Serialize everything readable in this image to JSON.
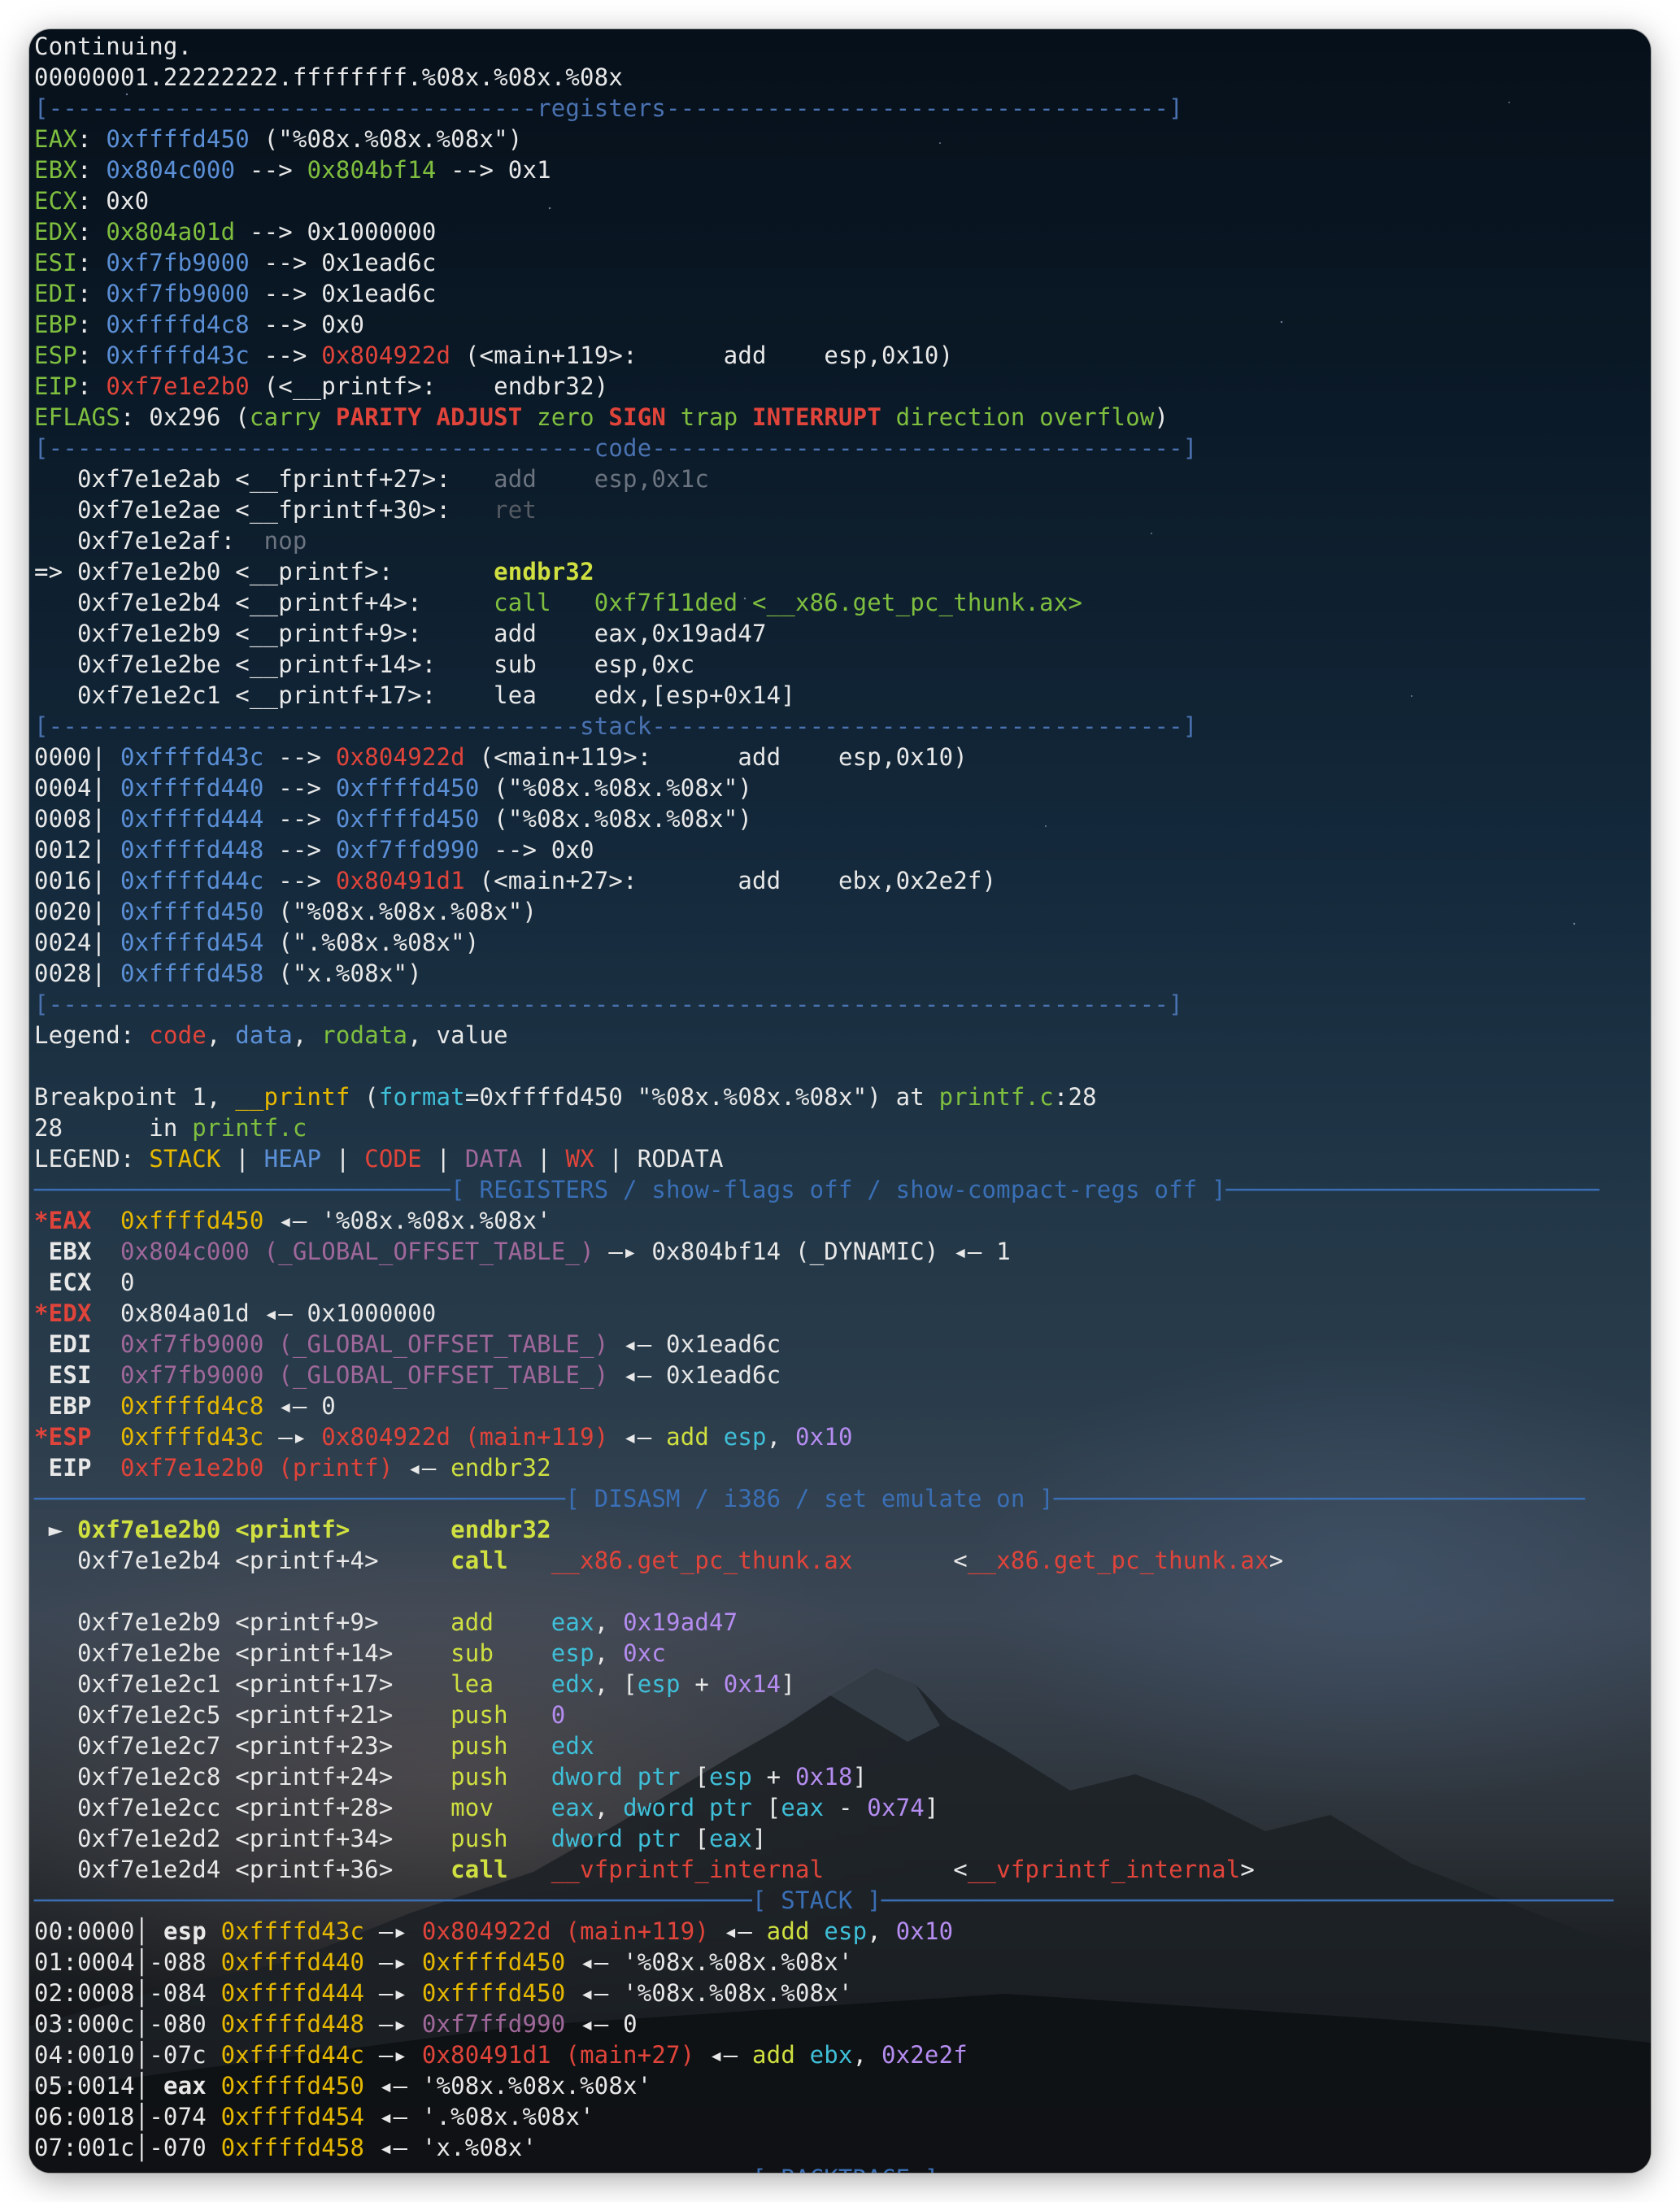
{
  "lines": [
    [
      [
        "w",
        "Continuing."
      ]
    ],
    [
      [
        "w",
        "00000001.22222222.ffffffff.%08x.%08x.%08x"
      ]
    ],
    [
      [
        "sepb",
        "[----------------------------------"
      ],
      [
        "sepb",
        "registers"
      ],
      [
        "sepb",
        "-----------------------------------]"
      ]
    ],
    [
      [
        "g",
        "EAX"
      ],
      [
        "w",
        ": "
      ],
      [
        "b",
        "0xffffd450"
      ],
      [
        "w",
        " (\"%08x.%08x.%08x\")"
      ]
    ],
    [
      [
        "g",
        "EBX"
      ],
      [
        "w",
        ": "
      ],
      [
        "b",
        "0x804c000"
      ],
      [
        "w",
        " --> "
      ],
      [
        "g",
        "0x804bf14"
      ],
      [
        "w",
        " --> 0x1"
      ]
    ],
    [
      [
        "g",
        "ECX"
      ],
      [
        "w",
        ": 0x0"
      ]
    ],
    [
      [
        "g",
        "EDX"
      ],
      [
        "w",
        ": "
      ],
      [
        "g",
        "0x804a01d"
      ],
      [
        "w",
        " --> 0x1000000"
      ]
    ],
    [
      [
        "g",
        "ESI"
      ],
      [
        "w",
        ": "
      ],
      [
        "b",
        "0xf7fb9000"
      ],
      [
        "w",
        " --> 0x1ead6c"
      ]
    ],
    [
      [
        "g",
        "EDI"
      ],
      [
        "w",
        ": "
      ],
      [
        "b",
        "0xf7fb9000"
      ],
      [
        "w",
        " --> 0x1ead6c"
      ]
    ],
    [
      [
        "g",
        "EBP"
      ],
      [
        "w",
        ": "
      ],
      [
        "b",
        "0xffffd4c8"
      ],
      [
        "w",
        " --> 0x0"
      ]
    ],
    [
      [
        "g",
        "ESP"
      ],
      [
        "w",
        ": "
      ],
      [
        "b",
        "0xffffd43c"
      ],
      [
        "w",
        " --> "
      ],
      [
        "r",
        "0x804922d"
      ],
      [
        "w",
        " (<main+119>:      add    esp,0x10)"
      ]
    ],
    [
      [
        "g",
        "EIP"
      ],
      [
        "w",
        ": "
      ],
      [
        "r",
        "0xf7e1e2b0"
      ],
      [
        "w",
        " (<__printf>:    endbr32)"
      ]
    ],
    [
      [
        "g",
        "EFLAGS"
      ],
      [
        "w",
        ": 0x296 ("
      ],
      [
        "g",
        "carry "
      ],
      [
        "rb",
        "PARITY ADJUST "
      ],
      [
        "g",
        "zero "
      ],
      [
        "rb",
        "SIGN "
      ],
      [
        "g",
        "trap "
      ],
      [
        "rb",
        "INTERRUPT "
      ],
      [
        "g",
        "direction overflow"
      ],
      [
        "w",
        ")"
      ]
    ],
    [
      [
        "sepb",
        "[--------------------------------------"
      ],
      [
        "sepb",
        "code"
      ],
      [
        "sepb",
        "-------------------------------------]"
      ]
    ],
    [
      [
        "w",
        "   0xf7e1e2ab <__fprintf+27>:   "
      ],
      [
        "gray",
        "add    esp,0x1c"
      ]
    ],
    [
      [
        "w",
        "   0xf7e1e2ae <__fprintf+30>:   "
      ],
      [
        "dk",
        "ret"
      ]
    ],
    [
      [
        "w",
        "   0xf7e1e2af:  "
      ],
      [
        "gray",
        "nop"
      ]
    ],
    [
      [
        "w",
        "=> 0xf7e1e2b0 <__printf>:       "
      ],
      [
        "ygb",
        "endbr32"
      ]
    ],
    [
      [
        "w",
        "   0xf7e1e2b4 <__printf+4>:     "
      ],
      [
        "g",
        "call   0xf7f11ded <__x86.get_pc_thunk.ax>"
      ]
    ],
    [
      [
        "w",
        "   0xf7e1e2b9 <__printf+9>:     add    eax,0x19ad47"
      ]
    ],
    [
      [
        "w",
        "   0xf7e1e2be <__printf+14>:    sub    esp,0xc"
      ]
    ],
    [
      [
        "w",
        "   0xf7e1e2c1 <__printf+17>:    lea    edx,[esp+0x14]"
      ]
    ],
    [
      [
        "sepb",
        "[-------------------------------------"
      ],
      [
        "sepb",
        "stack"
      ],
      [
        "sepb",
        "-------------------------------------]"
      ]
    ],
    [
      [
        "w",
        "0000| "
      ],
      [
        "b",
        "0xffffd43c"
      ],
      [
        "w",
        " --> "
      ],
      [
        "r",
        "0x804922d"
      ],
      [
        "w",
        " (<main+119>:      add    esp,0x10)"
      ]
    ],
    [
      [
        "w",
        "0004| "
      ],
      [
        "b",
        "0xffffd440"
      ],
      [
        "w",
        " --> "
      ],
      [
        "b",
        "0xffffd450"
      ],
      [
        "w",
        " (\"%08x.%08x.%08x\")"
      ]
    ],
    [
      [
        "w",
        "0008| "
      ],
      [
        "b",
        "0xffffd444"
      ],
      [
        "w",
        " --> "
      ],
      [
        "b",
        "0xffffd450"
      ],
      [
        "w",
        " (\"%08x.%08x.%08x\")"
      ]
    ],
    [
      [
        "w",
        "0012| "
      ],
      [
        "b",
        "0xffffd448"
      ],
      [
        "w",
        " --> "
      ],
      [
        "b",
        "0xf7ffd990"
      ],
      [
        "w",
        " --> 0x0"
      ]
    ],
    [
      [
        "w",
        "0016| "
      ],
      [
        "b",
        "0xffffd44c"
      ],
      [
        "w",
        " --> "
      ],
      [
        "r",
        "0x80491d1"
      ],
      [
        "w",
        " (<main+27>:       add    ebx,0x2e2f)"
      ]
    ],
    [
      [
        "w",
        "0020| "
      ],
      [
        "b",
        "0xffffd450"
      ],
      [
        "w",
        " (\"%08x.%08x.%08x\")"
      ]
    ],
    [
      [
        "w",
        "0024| "
      ],
      [
        "b",
        "0xffffd454"
      ],
      [
        "w",
        " (\".%08x.%08x\")"
      ]
    ],
    [
      [
        "w",
        "0028| "
      ],
      [
        "b",
        "0xffffd458"
      ],
      [
        "w",
        " (\"x.%08x\")"
      ]
    ],
    [
      [
        "sepb",
        "[------------------------------------------------------------------------------]"
      ]
    ],
    [
      [
        "w",
        "Legend: "
      ],
      [
        "r",
        "code"
      ],
      [
        "w",
        ", "
      ],
      [
        "b",
        "data"
      ],
      [
        "w",
        ", "
      ],
      [
        "g",
        "rodata"
      ],
      [
        "w",
        ", value"
      ]
    ],
    [
      [
        "w",
        " "
      ]
    ],
    [
      [
        "w",
        "Breakpoint 1, "
      ],
      [
        "y",
        "__printf"
      ],
      [
        "w",
        " ("
      ],
      [
        "c",
        "format"
      ],
      [
        "w",
        "=0xffffd450 \"%08x.%08x.%08x\") at "
      ],
      [
        "g",
        "printf.c"
      ],
      [
        "w",
        ":28"
      ]
    ],
    [
      [
        "w",
        "28      in "
      ],
      [
        "g",
        "printf.c"
      ]
    ],
    [
      [
        "w",
        "LEGEND: "
      ],
      [
        "y",
        "STACK"
      ],
      [
        "w",
        " | "
      ],
      [
        "b",
        "HEAP"
      ],
      [
        "w",
        " | "
      ],
      [
        "r",
        "CODE"
      ],
      [
        "w",
        " | "
      ],
      [
        "m",
        "DATA"
      ],
      [
        "w",
        " | "
      ],
      [
        "r",
        "WX"
      ],
      [
        "w",
        " | RODATA"
      ]
    ],
    [
      [
        "sepc",
        "─────────────────────────────[ REGISTERS / show-flags off / show-compact-regs off ]──────────────────────────"
      ]
    ],
    [
      [
        "rb",
        "*EAX"
      ],
      [
        "w",
        "  "
      ],
      [
        "y",
        "0xffffd450"
      ],
      [
        "w",
        " ◂— '%08x.%08x.%08x'"
      ]
    ],
    [
      [
        "bold",
        " EBX"
      ],
      [
        "w",
        "  "
      ],
      [
        "m",
        "0x804c000 (_GLOBAL_OFFSET_TABLE_)"
      ],
      [
        "w",
        " —▸ 0x804bf14 (_DYNAMIC) ◂— 1"
      ]
    ],
    [
      [
        "bold",
        " ECX"
      ],
      [
        "w",
        "  0"
      ]
    ],
    [
      [
        "rb",
        "*EDX"
      ],
      [
        "w",
        "  0x804a01d ◂— 0x1000000"
      ]
    ],
    [
      [
        "bold",
        " EDI"
      ],
      [
        "w",
        "  "
      ],
      [
        "m",
        "0xf7fb9000 (_GLOBAL_OFFSET_TABLE_)"
      ],
      [
        "w",
        " ◂— 0x1ead6c"
      ]
    ],
    [
      [
        "bold",
        " ESI"
      ],
      [
        "w",
        "  "
      ],
      [
        "m",
        "0xf7fb9000 (_GLOBAL_OFFSET_TABLE_)"
      ],
      [
        "w",
        " ◂— 0x1ead6c"
      ]
    ],
    [
      [
        "bold",
        " EBP"
      ],
      [
        "w",
        "  "
      ],
      [
        "y",
        "0xffffd4c8"
      ],
      [
        "w",
        " ◂— 0"
      ]
    ],
    [
      [
        "rb",
        "*ESP"
      ],
      [
        "w",
        "  "
      ],
      [
        "y",
        "0xffffd43c"
      ],
      [
        "w",
        " —▸ "
      ],
      [
        "r",
        "0x804922d (main+119)"
      ],
      [
        "w",
        " ◂— "
      ],
      [
        "yg",
        "add "
      ],
      [
        "c",
        "esp"
      ],
      [
        "w",
        ", "
      ],
      [
        "p",
        "0x10"
      ]
    ],
    [
      [
        "bold",
        " EIP"
      ],
      [
        "w",
        "  "
      ],
      [
        "r",
        "0xf7e1e2b0 (printf)"
      ],
      [
        "w",
        " ◂— "
      ],
      [
        "yg",
        "endbr32"
      ]
    ],
    [
      [
        "sepc",
        "─────────────────────────────────────[ DISASM / i386 / set emulate on ]─────────────────────────────────────"
      ]
    ],
    [
      [
        "w",
        " ► "
      ],
      [
        "ygb",
        "0xf7e1e2b0 <printf>       "
      ],
      [
        "ygb",
        "endbr32"
      ]
    ],
    [
      [
        "w",
        "   0xf7e1e2b4 <printf+4>     "
      ],
      [
        "ygb",
        "call   "
      ],
      [
        "r",
        "__x86.get_pc_thunk.ax"
      ],
      [
        "w",
        "       <"
      ],
      [
        "r",
        "__x86.get_pc_thunk.ax"
      ],
      [
        "w",
        ">"
      ]
    ],
    [
      [
        "w",
        " "
      ]
    ],
    [
      [
        "w",
        "   0xf7e1e2b9 <printf+9>     "
      ],
      [
        "yg",
        "add    "
      ],
      [
        "c",
        "eax"
      ],
      [
        "w",
        ", "
      ],
      [
        "p",
        "0x19ad47"
      ]
    ],
    [
      [
        "w",
        "   0xf7e1e2be <printf+14>    "
      ],
      [
        "yg",
        "sub    "
      ],
      [
        "c",
        "esp"
      ],
      [
        "w",
        ", "
      ],
      [
        "p",
        "0xc"
      ]
    ],
    [
      [
        "w",
        "   0xf7e1e2c1 <printf+17>    "
      ],
      [
        "yg",
        "lea    "
      ],
      [
        "c",
        "edx"
      ],
      [
        "w",
        ", ["
      ],
      [
        "c",
        "esp"
      ],
      [
        "w",
        " + "
      ],
      [
        "p",
        "0x14"
      ],
      [
        "w",
        "]"
      ]
    ],
    [
      [
        "w",
        "   0xf7e1e2c5 <printf+21>    "
      ],
      [
        "yg",
        "push   "
      ],
      [
        "p",
        "0"
      ]
    ],
    [
      [
        "w",
        "   0xf7e1e2c7 <printf+23>    "
      ],
      [
        "yg",
        "push   "
      ],
      [
        "c",
        "edx"
      ]
    ],
    [
      [
        "w",
        "   0xf7e1e2c8 <printf+24>    "
      ],
      [
        "yg",
        "push   "
      ],
      [
        "c",
        "dword ptr"
      ],
      [
        "w",
        " ["
      ],
      [
        "c",
        "esp"
      ],
      [
        "w",
        " + "
      ],
      [
        "p",
        "0x18"
      ],
      [
        "w",
        "]"
      ]
    ],
    [
      [
        "w",
        "   0xf7e1e2cc <printf+28>    "
      ],
      [
        "yg",
        "mov    "
      ],
      [
        "c",
        "eax"
      ],
      [
        "w",
        ", "
      ],
      [
        "c",
        "dword ptr"
      ],
      [
        "w",
        " ["
      ],
      [
        "c",
        "eax"
      ],
      [
        "w",
        " - "
      ],
      [
        "p",
        "0x74"
      ],
      [
        "w",
        "]"
      ]
    ],
    [
      [
        "w",
        "   0xf7e1e2d2 <printf+34>    "
      ],
      [
        "yg",
        "push   "
      ],
      [
        "c",
        "dword ptr"
      ],
      [
        "w",
        " ["
      ],
      [
        "c",
        "eax"
      ],
      [
        "w",
        "]"
      ]
    ],
    [
      [
        "w",
        "   0xf7e1e2d4 <printf+36>    "
      ],
      [
        "ygb",
        "call   "
      ],
      [
        "r",
        "__vfprintf_internal"
      ],
      [
        "w",
        "         <"
      ],
      [
        "r",
        "__vfprintf_internal"
      ],
      [
        "w",
        ">"
      ]
    ],
    [
      [
        "sepc",
        "──────────────────────────────────────────────────[ STACK ]───────────────────────────────────────────────────"
      ]
    ],
    [
      [
        "w",
        "00:0000│ "
      ],
      [
        "bold",
        "esp "
      ],
      [
        "y",
        "0xffffd43c"
      ],
      [
        "w",
        " —▸ "
      ],
      [
        "r",
        "0x804922d (main+119)"
      ],
      [
        "w",
        " ◂— "
      ],
      [
        "yg",
        "add "
      ],
      [
        "c",
        "esp"
      ],
      [
        "w",
        ", "
      ],
      [
        "p",
        "0x10"
      ]
    ],
    [
      [
        "w",
        "01:0004│-088 "
      ],
      [
        "y",
        "0xffffd440"
      ],
      [
        "w",
        " —▸ "
      ],
      [
        "y",
        "0xffffd450"
      ],
      [
        "w",
        " ◂— '%08x.%08x.%08x'"
      ]
    ],
    [
      [
        "w",
        "02:0008│-084 "
      ],
      [
        "y",
        "0xffffd444"
      ],
      [
        "w",
        " —▸ "
      ],
      [
        "y",
        "0xffffd450"
      ],
      [
        "w",
        " ◂— '%08x.%08x.%08x'"
      ]
    ],
    [
      [
        "w",
        "03:000c│-080 "
      ],
      [
        "y",
        "0xffffd448"
      ],
      [
        "w",
        " —▸ "
      ],
      [
        "m",
        "0xf7ffd990"
      ],
      [
        "w",
        " ◂— 0"
      ]
    ],
    [
      [
        "w",
        "04:0010│-07c "
      ],
      [
        "y",
        "0xffffd44c"
      ],
      [
        "w",
        " —▸ "
      ],
      [
        "r",
        "0x80491d1 (main+27)"
      ],
      [
        "w",
        " ◂— "
      ],
      [
        "yg",
        "add "
      ],
      [
        "c",
        "ebx"
      ],
      [
        "w",
        ", "
      ],
      [
        "p",
        "0x2e2f"
      ]
    ],
    [
      [
        "w",
        "05:0014│ "
      ],
      [
        "bold",
        "eax "
      ],
      [
        "y",
        "0xffffd450"
      ],
      [
        "w",
        " ◂— '%08x.%08x.%08x'"
      ]
    ],
    [
      [
        "w",
        "06:0018│-074 "
      ],
      [
        "y",
        "0xffffd454"
      ],
      [
        "w",
        " ◂— '.%08x.%08x'"
      ]
    ],
    [
      [
        "w",
        "07:001c│-070 "
      ],
      [
        "y",
        "0xffffd458"
      ],
      [
        "w",
        " ◂— 'x.%08x'"
      ]
    ],
    [
      [
        "sepc",
        "                                                  [ BACKTRACE ]"
      ]
    ]
  ]
}
